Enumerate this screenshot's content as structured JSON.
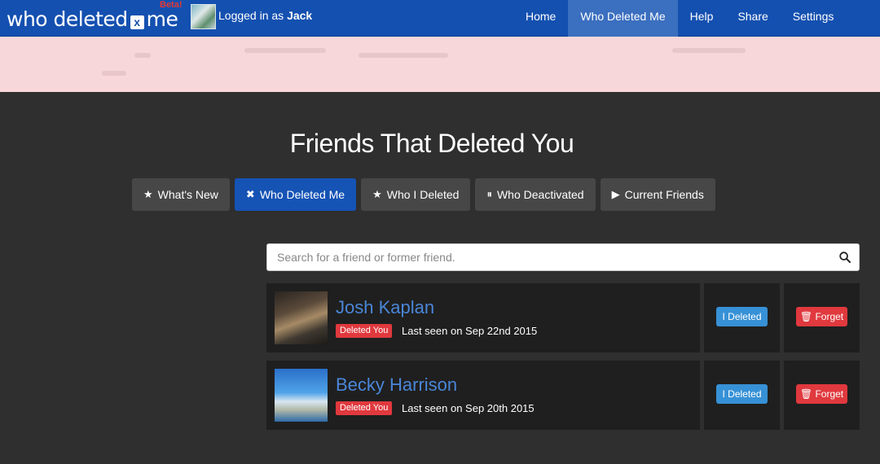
{
  "brand": {
    "name_left": "who deleted",
    "name_x": "x",
    "name_right": "me",
    "beta": "Beta!"
  },
  "user": {
    "logged_prefix": "Logged in as",
    "username": "Jack"
  },
  "nav": {
    "items": [
      {
        "label": "Home"
      },
      {
        "label": "Who Deleted Me"
      },
      {
        "label": "Help"
      },
      {
        "label": "Share"
      },
      {
        "label": "Settings"
      }
    ],
    "active_index": 1
  },
  "page": {
    "title": "Friends That Deleted You"
  },
  "tabs": [
    {
      "icon": "★",
      "label": "What's New"
    },
    {
      "icon": "✖",
      "label": "Who Deleted Me"
    },
    {
      "icon": "★",
      "label": "Who I Deleted"
    },
    {
      "icon": "⏸",
      "label": "Who Deactivated"
    },
    {
      "icon": "▶",
      "label": "Current Friends"
    }
  ],
  "search": {
    "placeholder": "Search for a friend or former friend.",
    "value": ""
  },
  "friends": [
    {
      "name": "Josh Kaplan",
      "status": "Deleted You",
      "last_seen": "Last seen on Sep 22nd 2015",
      "action1": "I Deleted",
      "action2": "Forget"
    },
    {
      "name": "Becky Harrison",
      "status": "Deleted You",
      "last_seen": "Last seen on Sep 20th 2015",
      "action1": "I Deleted",
      "action2": "Forget"
    }
  ],
  "colors": {
    "nav": "#1450b0",
    "active_tab": "#1553b5",
    "badge_red": "#e0393e",
    "button_blue": "#3791d6",
    "banner": "#f8d7da"
  }
}
